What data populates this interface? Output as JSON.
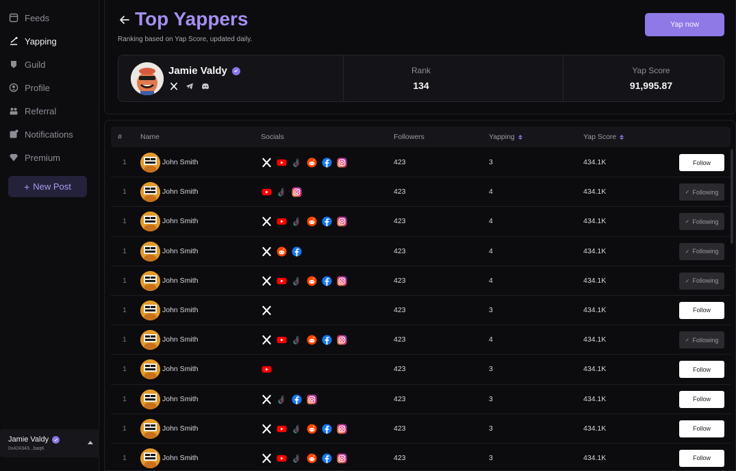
{
  "sidebar": {
    "items": [
      {
        "label": "Feeds",
        "icon": "feeds-icon",
        "active": false
      },
      {
        "label": "Yapping",
        "icon": "yapping-icon",
        "active": true
      },
      {
        "label": "Guild",
        "icon": "guild-icon",
        "active": false
      },
      {
        "label": "Profile",
        "icon": "profile-icon",
        "active": false
      },
      {
        "label": "Referral",
        "icon": "referral-icon",
        "active": false
      },
      {
        "label": "Notifications",
        "icon": "notifications-icon",
        "active": false
      },
      {
        "label": "Premium",
        "icon": "premium-icon",
        "active": false
      }
    ],
    "new_post_label": "New Post",
    "user": {
      "name": "Jamie Valdy",
      "address": "0x424343...baqK"
    }
  },
  "header": {
    "title": "Top Yappers",
    "subtitle": "Ranking based on Yap Score, updated daily.",
    "yap_now_label": "Yap now"
  },
  "profile_card": {
    "name": "Jamie Valdy",
    "socials": [
      "x",
      "telegram",
      "discord"
    ],
    "rank_label": "Rank",
    "rank_value": "134",
    "score_label": "Yap Score",
    "score_value": "91,995.87"
  },
  "table": {
    "headers": {
      "rank": "#",
      "name": "Name",
      "socials": "Socials",
      "followers": "Followers",
      "yapping": "Yapping",
      "score": "Yap Score"
    },
    "follow_label": "Follow",
    "following_label": "Following",
    "rows": [
      {
        "rank": "1",
        "name": "John Smith",
        "socials": [
          "x",
          "youtube",
          "tiktok",
          "reddit",
          "facebook",
          "instagram"
        ],
        "followers": "423",
        "yapping": "3",
        "score": "434.1K",
        "following": false
      },
      {
        "rank": "1",
        "name": "John Smith",
        "socials": [
          "youtube",
          "tiktok",
          "instagram"
        ],
        "followers": "423",
        "yapping": "4",
        "score": "434.1K",
        "following": true
      },
      {
        "rank": "1",
        "name": "John Smith",
        "socials": [
          "x",
          "youtube",
          "tiktok",
          "reddit",
          "facebook",
          "instagram"
        ],
        "followers": "423",
        "yapping": "4",
        "score": "434.1K",
        "following": true
      },
      {
        "rank": "1",
        "name": "John Smith",
        "socials": [
          "x",
          "reddit",
          "facebook"
        ],
        "followers": "423",
        "yapping": "4",
        "score": "434.1K",
        "following": true
      },
      {
        "rank": "1",
        "name": "John Smith",
        "socials": [
          "x",
          "youtube",
          "tiktok",
          "reddit",
          "facebook",
          "instagram"
        ],
        "followers": "423",
        "yapping": "4",
        "score": "434.1K",
        "following": true
      },
      {
        "rank": "1",
        "name": "John Smith",
        "socials": [
          "x"
        ],
        "followers": "423",
        "yapping": "3",
        "score": "434.1K",
        "following": false
      },
      {
        "rank": "1",
        "name": "John Smith",
        "socials": [
          "x",
          "youtube",
          "tiktok",
          "reddit",
          "facebook",
          "instagram"
        ],
        "followers": "423",
        "yapping": "4",
        "score": "434.1K",
        "following": true
      },
      {
        "rank": "1",
        "name": "John Smith",
        "socials": [
          "youtube"
        ],
        "followers": "423",
        "yapping": "3",
        "score": "434.1K",
        "following": false
      },
      {
        "rank": "1",
        "name": "John Smith",
        "socials": [
          "x",
          "tiktok",
          "facebook",
          "instagram"
        ],
        "followers": "423",
        "yapping": "3",
        "score": "434.1K",
        "following": false
      },
      {
        "rank": "1",
        "name": "John Smith",
        "socials": [
          "x",
          "youtube",
          "tiktok",
          "reddit",
          "facebook",
          "instagram"
        ],
        "followers": "423",
        "yapping": "3",
        "score": "434.1K",
        "following": false
      },
      {
        "rank": "1",
        "name": "John Smith",
        "socials": [
          "x",
          "youtube",
          "tiktok",
          "reddit",
          "facebook",
          "instagram"
        ],
        "followers": "423",
        "yapping": "3",
        "score": "434.1K",
        "following": false
      }
    ]
  },
  "colors": {
    "accent": "#8e79e6",
    "title": "#a58ff0",
    "background": "#0b0b0d"
  }
}
